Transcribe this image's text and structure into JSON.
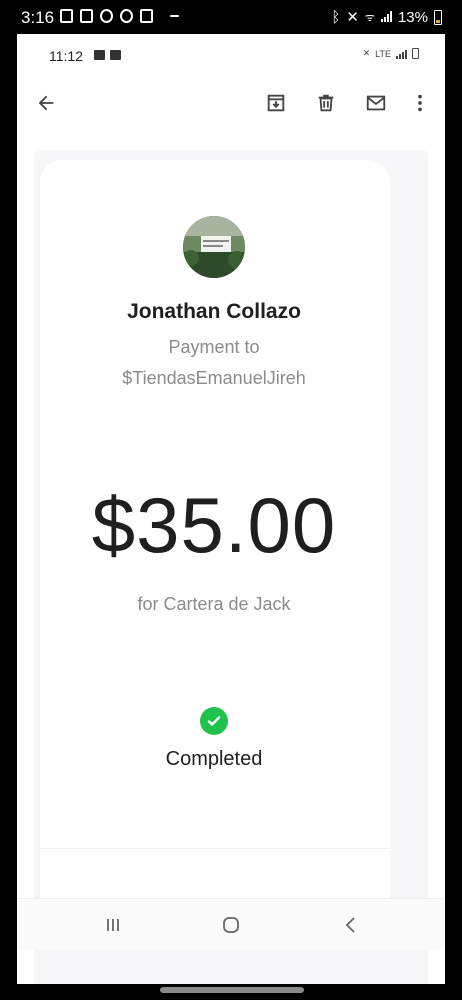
{
  "device_status": {
    "time": "3:16",
    "battery": "13%",
    "icons": [
      "battery-saver-icon",
      "facebook-icon",
      "download-icon",
      "nodes-icon",
      "news-icon",
      "bluetooth-icon",
      "mute-icon",
      "wifi-icon",
      "signal-icon"
    ]
  },
  "inner_status": {
    "time": "11:12",
    "icons": [
      "image-icon",
      "hd-icon",
      "mute-icon",
      "lte-icon",
      "signal-icon",
      "battery-icon"
    ],
    "lte": "LTE"
  },
  "actionbar": {
    "icons": [
      "back-arrow-icon",
      "archive-icon",
      "delete-icon",
      "mail-icon",
      "more-vert-icon"
    ]
  },
  "payment": {
    "sender_name": "Jonathan Collazo",
    "payment_to_label": "Payment to",
    "recipient_handle": "$TiendasEmanuelJireh",
    "amount": "$35.00",
    "memo": "for Cartera de Jack",
    "status": "Completed",
    "status_color": "#1fc24d"
  },
  "navbar": {
    "icons": [
      "recent-apps-icon",
      "home-icon",
      "back-icon"
    ]
  }
}
